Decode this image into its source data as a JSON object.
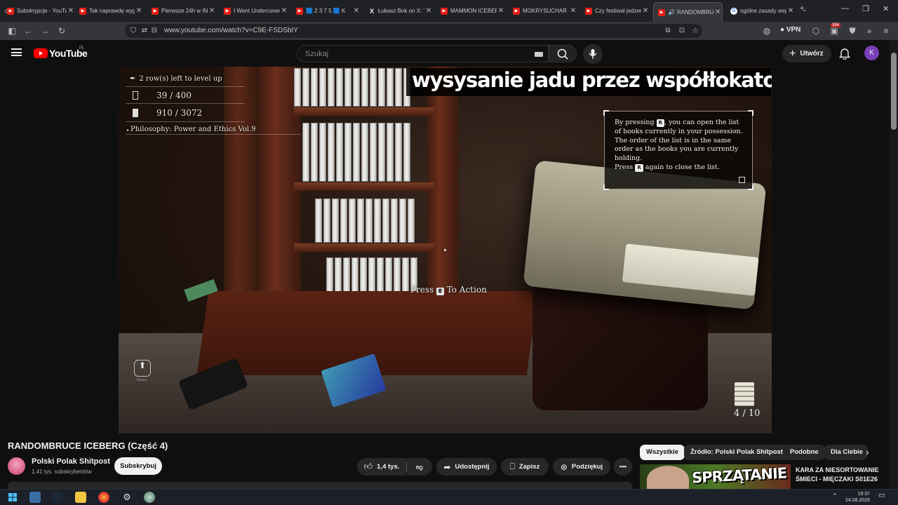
{
  "browser": {
    "tabs": [
      {
        "label": "Subskrypcje - YouTube",
        "icon": "youtube-icon"
      },
      {
        "label": "Tak naprawdę wygląda",
        "icon": "youtube-icon"
      },
      {
        "label": "Pierwsze 24h w IN",
        "icon": "youtube-icon"
      },
      {
        "label": "I Went Undercover",
        "icon": "youtube-icon"
      },
      {
        "label": "🟦 2 3 7 5 🟦 K",
        "icon": "youtube-icon"
      },
      {
        "label": "Łukasz Bok on X: \"",
        "icon": "x-icon"
      },
      {
        "label": "MAMMON ICEBERG",
        "icon": "youtube-icon"
      },
      {
        "label": "MOKRYSUCHAR -",
        "icon": "youtube-icon"
      },
      {
        "label": "Czy festiwal jedzenia",
        "icon": "youtube-icon"
      },
      {
        "label": "RANDOMBRUCE",
        "icon": "youtube-icon",
        "active": true
      },
      {
        "label": "ogólne zasady wsp",
        "icon": "google-icon"
      }
    ],
    "url": "www.youtube.com/watch?v=C9E-FSDSbIY",
    "vpn_label": "VPN",
    "extension_badge": "384"
  },
  "youtube": {
    "logo_text": "YouTube",
    "country_code": "PL",
    "search_placeholder": "Szukaj",
    "create_label": "Utwórz",
    "avatar_letter": "K"
  },
  "video_overlay": {
    "caption": "wysysanie jadu przez współłokatorke",
    "rows_left": "2 row(s) left to level up",
    "count1": "39 / 400",
    "count2": "910 / 3072",
    "book_title": "Philosophy: Power and Ethics Vol.9",
    "tip": {
      "pre1": "By pressing",
      "key": "R",
      "post1": ", you can open the list of books currently in your possession.",
      "line2": "The order of the list is in the same order as the books you are currently holding.",
      "pre3": "Press",
      "post3": "again to close the list."
    },
    "press_pre": "Press",
    "press_key": "E",
    "press_post": "To Action",
    "books_counter": "4 / 10",
    "jump_label": "Space"
  },
  "video_info": {
    "title": "RANDOMBRUCE ICEBERG (Część 4)",
    "channel_name": "Polski Polak Shitpost",
    "subscribers": "1,41 tys. subskrybentów",
    "subscribe_label": "Subskrybuj",
    "likes": "1,4 tys.",
    "share_label": "Udostępnij",
    "save_label": "Zapisz",
    "thanks_label": "Podziękuj"
  },
  "sidebar": {
    "chips": [
      "Wszystkie",
      "Źródło: Polski Polak Shitpost",
      "Podobne",
      "Dla Ciebie"
    ],
    "reco_thumb_text": "SPRZĄTANIE",
    "reco_title": "KARA ZA NIESORTOWANIE ŚMIECI - MIĘCZAKI S01E26"
  },
  "taskbar": {
    "time": "19:37",
    "date": "24.08.2026"
  }
}
